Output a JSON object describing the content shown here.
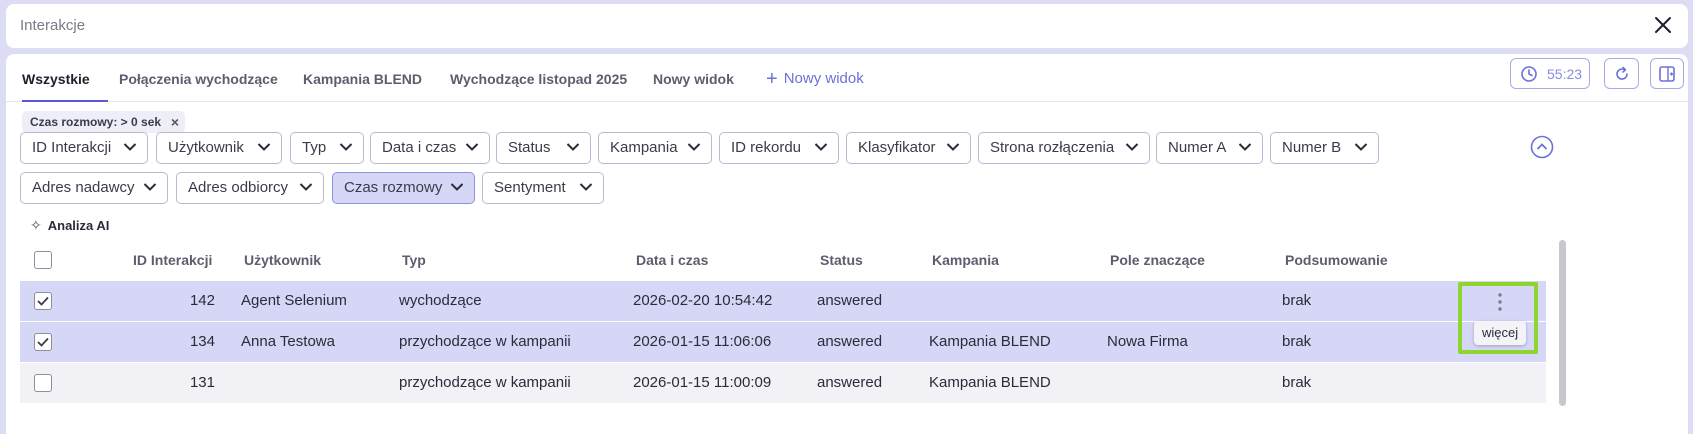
{
  "window": {
    "title": "Interakcje"
  },
  "tabs": [
    {
      "label": "Wszystkie",
      "active": true
    },
    {
      "label": "Połączenia wychodzące"
    },
    {
      "label": "Kampania BLEND"
    },
    {
      "label": "Wychodzące listopad 2025"
    },
    {
      "label": "Nowy widok"
    }
  ],
  "add_view_label": "Nowy widok",
  "toolbar": {
    "timer_value": "55:23",
    "timer_icon": "clock-icon",
    "refresh_icon": "refresh-icon",
    "layout_icon": "panel-layout-icon"
  },
  "active_filter_chip": {
    "label": "Czas rozmowy: > 0 sek"
  },
  "filters": [
    "ID Interakcji",
    "Użytkownik",
    "Typ",
    "Data i czas",
    "Status",
    "Kampania",
    "ID rekordu",
    "Klasyfikator",
    "Strona rozłączenia",
    "Numer A",
    "Numer B",
    "Adres nadawcy",
    "Adres odbiorcy",
    "Czas rozmowy",
    "Sentyment"
  ],
  "active_filter_index": 13,
  "ai_button": {
    "label": "Analiza AI"
  },
  "table": {
    "columns": [
      "ID Interakcji",
      "Użytkownik",
      "Typ",
      "Data i czas",
      "Status",
      "Kampania",
      "Pole znaczące",
      "Podsumowanie"
    ],
    "rows": [
      {
        "selected": true,
        "id": "142",
        "user": "Agent Selenium",
        "type": "wychodzące",
        "datetime": "2026-02-20 10:54:42",
        "status": "answered",
        "campaign": "",
        "field": "",
        "summary": "brak"
      },
      {
        "selected": true,
        "id": "134",
        "user": "Anna Testowa",
        "type": "przychodzące w kampanii",
        "datetime": "2026-01-15 11:06:06",
        "status": "answered",
        "campaign": "Kampania BLEND",
        "field": "Nowa Firma",
        "summary": "brak"
      },
      {
        "selected": false,
        "id": "131",
        "user": "",
        "type": "przychodzące w kampanii",
        "datetime": "2026-01-15 11:00:09",
        "status": "answered",
        "campaign": "Kampania BLEND",
        "field": "",
        "summary": "brak"
      }
    ]
  },
  "row_actions": {
    "tooltip": "więcej",
    "highlight_color": "#8fd530"
  },
  "colors": {
    "accent": "#6c70d8",
    "selected_row": "#d6d7f7",
    "background": "#dcdcf4"
  }
}
